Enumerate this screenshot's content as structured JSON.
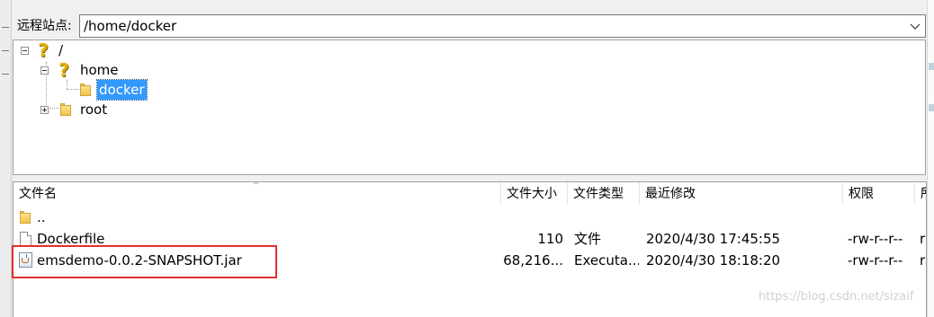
{
  "remote_site": {
    "label": "远程站点:",
    "path": "/home/docker"
  },
  "tree": {
    "root": {
      "label": "/",
      "icon": "question-icon"
    },
    "home": {
      "label": "home",
      "icon": "question-icon"
    },
    "docker": {
      "label": "docker",
      "icon": "folder-icon",
      "selected": true
    },
    "rootdir": {
      "label": "root",
      "icon": "folder-icon"
    }
  },
  "file_list": {
    "columns": [
      "文件名",
      "文件大小",
      "文件类型",
      "最近修改",
      "权限",
      "所"
    ],
    "rows": [
      {
        "name": "..",
        "size": "",
        "type": "",
        "modified": "",
        "perms": "",
        "owner": "",
        "icon": "folder-icon"
      },
      {
        "name": "Dockerfile",
        "size": "110",
        "type": "文件",
        "modified": "2020/4/30 17:45:55",
        "perms": "-rw-r--r--",
        "owner": "r",
        "icon": "file-icon"
      },
      {
        "name": "emsdemo-0.0.2-SNAPSHOT.jar",
        "size": "68,216...",
        "type": "Executa...",
        "modified": "2020/4/30 18:18:20",
        "perms": "-rw-r--r--",
        "owner": "r",
        "icon": "java-jar-icon"
      }
    ]
  },
  "colors": {
    "selection": "#3399ff",
    "highlight_box": "#e0302e"
  },
  "watermark": "https://blog.csdn.net/sizaif"
}
